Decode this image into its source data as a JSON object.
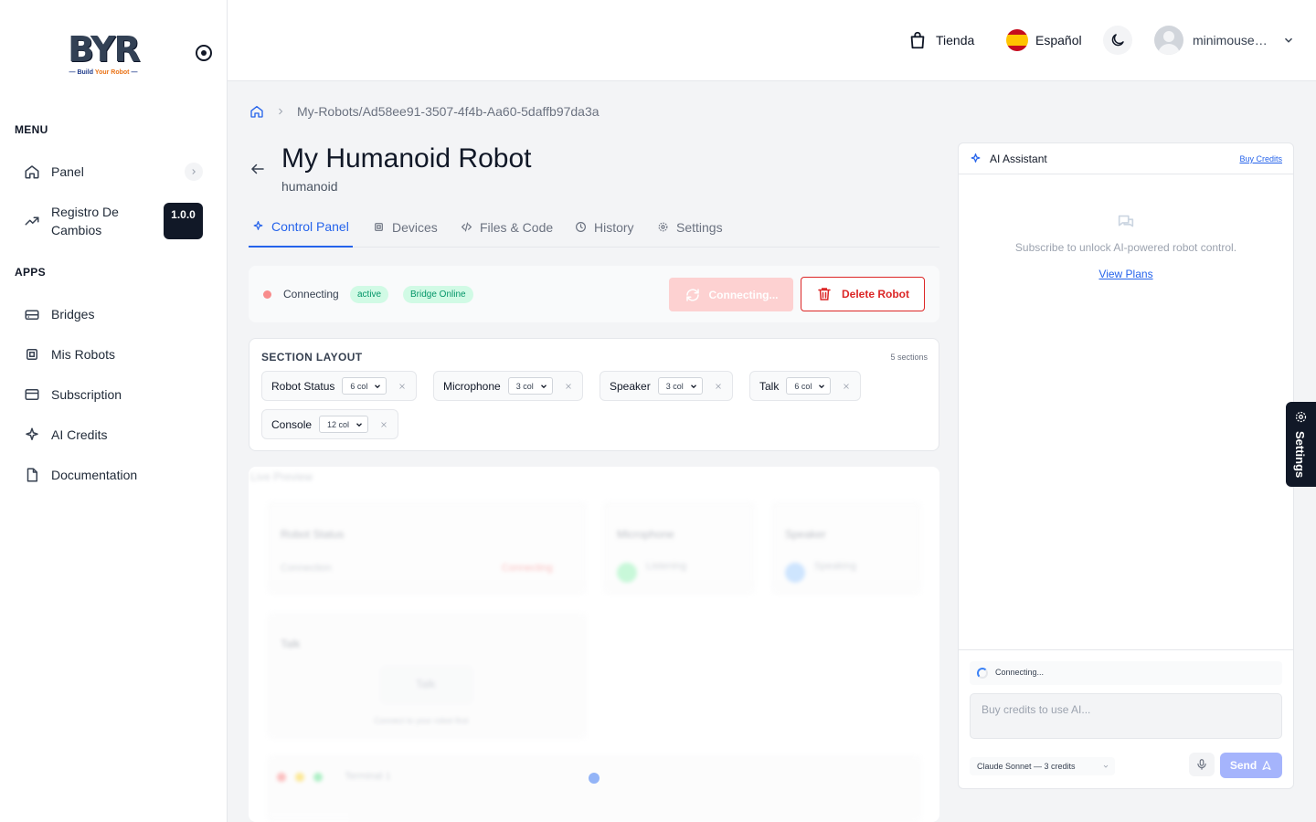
{
  "logo": {
    "text": "BYR",
    "tagline_a": "Build ",
    "tagline_b": "Your Robot"
  },
  "sidebar": {
    "menu_title": "MENU",
    "apps_title": "APPS",
    "menu_items": [
      {
        "label": "Panel",
        "icon": "home-icon"
      },
      {
        "label": "Registro De Cambios",
        "icon": "trending-icon",
        "badge": "1.0.0"
      }
    ],
    "app_items": [
      {
        "label": "Bridges",
        "icon": "bridge-icon"
      },
      {
        "label": "Mis Robots",
        "icon": "chip-icon"
      },
      {
        "label": "Subscription",
        "icon": "card-icon"
      },
      {
        "label": "AI Credits",
        "icon": "sparkle-icon"
      },
      {
        "label": "Documentation",
        "icon": "document-icon"
      }
    ]
  },
  "header": {
    "store_label": "Tienda",
    "language_label": "Español",
    "user_name": "minimouse…"
  },
  "breadcrumb": {
    "path": "My-Robots/Ad58ee91-3507-4f4b-Aa60-5daffb97da3a"
  },
  "robot": {
    "title": "My Humanoid Robot",
    "type": "humanoid"
  },
  "tabs": [
    {
      "label": "Control Panel",
      "active": true
    },
    {
      "label": "Devices",
      "active": false
    },
    {
      "label": "Files & Code",
      "active": false
    },
    {
      "label": "History",
      "active": false
    },
    {
      "label": "Settings",
      "active": false
    }
  ],
  "status": {
    "text": "Connecting",
    "pill_active": "active",
    "pill_bridge": "Bridge Online",
    "connect_button": "Connecting...",
    "delete_button": "Delete Robot"
  },
  "section_layout": {
    "title": "SECTION LAYOUT",
    "count": "5 sections",
    "sections": [
      {
        "name": "Robot Status",
        "cols": "6 col"
      },
      {
        "name": "Microphone",
        "cols": "3 col"
      },
      {
        "name": "Speaker",
        "cols": "3 col"
      },
      {
        "name": "Talk",
        "cols": "6 col"
      },
      {
        "name": "Console",
        "cols": "12 col"
      }
    ]
  },
  "preview": {
    "title": "Live Preview",
    "robot_status": "Robot Status",
    "connection": "Connection",
    "connecting": "Connecting",
    "microphone": "Microphone",
    "listening": "Listening",
    "speaker": "Speaker",
    "speaking": "Speaking",
    "talk": "Talk",
    "talk_btn": "Talk",
    "talk_hint": "Connect to your robot first",
    "terminal": "Terminal 1"
  },
  "ai": {
    "title": "AI Assistant",
    "buy_credits": "Buy Credits",
    "message": "Subscribe to unlock AI-powered robot control.",
    "view_plans": "View Plans",
    "connecting": "Connecting...",
    "input_placeholder": "Buy credits to use AI...",
    "model": "Claude Sonnet — 3 credits",
    "send": "Send"
  },
  "settings_tab": {
    "label": "Settings"
  },
  "colors": {
    "accent": "#2563eb",
    "danger": "#dc2626",
    "success": "#059669",
    "dark": "#111827"
  }
}
